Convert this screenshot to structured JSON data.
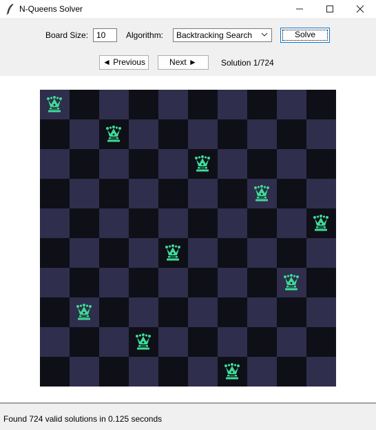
{
  "window": {
    "title": "N-Queens Solver",
    "minimize_glyph": "—",
    "maximize_glyph": "☐",
    "close_glyph": "✕"
  },
  "controls": {
    "board_size_label": "Board Size:",
    "board_size_value": "10",
    "algorithm_label": "Algorithm:",
    "algorithm_selected": "Backtracking Search",
    "solve_label": "Solve",
    "previous_label": "◄ Previous",
    "next_label": "Next ►",
    "solution_counter": "Solution 1/724"
  },
  "board": {
    "size": 10,
    "queen_columns_by_row": [
      0,
      2,
      5,
      7,
      9,
      4,
      8,
      1,
      3,
      6
    ],
    "light_square_color": "#2f2e4c",
    "dark_square_color": "#0f0f18",
    "queen_color": "#3ddc97",
    "queen_icon": "crown-icon"
  },
  "status": {
    "message": "Found 724 valid solutions in 0.125 seconds"
  }
}
